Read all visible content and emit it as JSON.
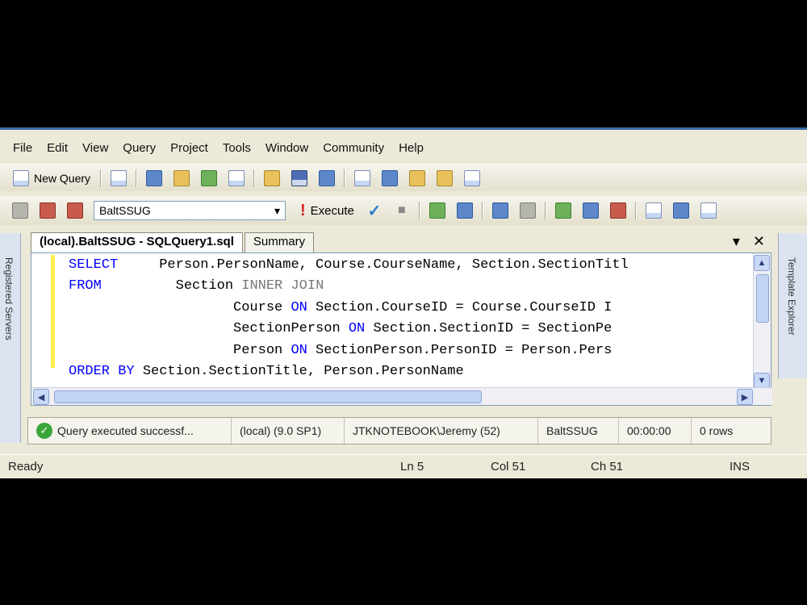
{
  "menu": [
    "File",
    "Edit",
    "View",
    "Query",
    "Project",
    "Tools",
    "Window",
    "Community",
    "Help"
  ],
  "toolbar1": {
    "new_query_label": "New Query"
  },
  "toolbar2": {
    "database": "BaltSSUG",
    "execute_label": "Execute"
  },
  "side": {
    "left_label": "Registered Servers",
    "right_label": "Template Explorer"
  },
  "tabs": [
    {
      "label": "(local).BaltSSUG - SQLQuery1.sql",
      "active": true
    },
    {
      "label": "Summary",
      "active": false
    }
  ],
  "editor": {
    "lines": [
      [
        [
          "kw",
          "SELECT"
        ],
        [
          "t",
          "     Person.PersonName, Course.CourseName, Section.SectionTitl"
        ]
      ],
      [
        [
          "kw",
          "FROM"
        ],
        [
          "t",
          "         Section "
        ],
        [
          "op",
          "INNER JOIN"
        ]
      ],
      [
        [
          "t",
          "                    Course "
        ],
        [
          "kw",
          "ON"
        ],
        [
          "t",
          " Section.CourseID = Course.CourseID I"
        ]
      ],
      [
        [
          "t",
          "                    SectionPerson "
        ],
        [
          "kw",
          "ON"
        ],
        [
          "t",
          " Section.SectionID = SectionPe"
        ]
      ],
      [
        [
          "t",
          "                    Person "
        ],
        [
          "kw",
          "ON"
        ],
        [
          "t",
          " SectionPerson.PersonID = Person.Pers"
        ]
      ],
      [
        [
          "kw",
          "ORDER BY"
        ],
        [
          "t",
          " Section.SectionTitle, Person.PersonName"
        ]
      ]
    ]
  },
  "query_status": {
    "message": "Query executed successf...",
    "server": "(local) (9.0 SP1)",
    "user": "JTKNOTEBOOK\\Jeremy (52)",
    "database": "BaltSSUG",
    "time": "00:00:00",
    "rows": "0 rows"
  },
  "status": {
    "ready": "Ready",
    "ln": "Ln 5",
    "col": "Col 51",
    "ch": "Ch 51",
    "ins": "INS"
  },
  "colors": {
    "keyword": "#0000ff",
    "operator": "#777777",
    "chrome": "#ece9d8",
    "title_accent": "#3a6ea5"
  }
}
